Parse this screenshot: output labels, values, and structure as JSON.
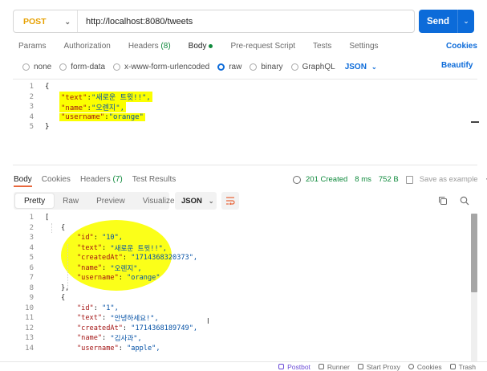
{
  "request": {
    "method": "POST",
    "url": "http://localhost:8080/tweets",
    "send_label": "Send"
  },
  "request_tabs": [
    {
      "label": "Params"
    },
    {
      "label": "Authorization"
    },
    {
      "label": "Headers",
      "count": "(8)"
    },
    {
      "label": "Body"
    },
    {
      "label": "Pre-request Script"
    },
    {
      "label": "Tests"
    },
    {
      "label": "Settings"
    }
  ],
  "cookies_link": "Cookies",
  "body_types": [
    "none",
    "form-data",
    "x-www-form-urlencoded",
    "raw",
    "binary",
    "GraphQL"
  ],
  "body_format": "JSON",
  "beautify_label": "Beautify",
  "request_body_lines": [
    {
      "n": "1",
      "text": "{"
    },
    {
      "n": "2",
      "key": "\"text\"",
      "value": "\"새로운 트윗!!\","
    },
    {
      "n": "3",
      "key": "\"name\"",
      "value": "\"오렌지\","
    },
    {
      "n": "4",
      "key": "\"username\"",
      "value": "\"orange\""
    },
    {
      "n": "5",
      "text": "}"
    }
  ],
  "response_tabs": [
    {
      "label": "Body"
    },
    {
      "label": "Cookies"
    },
    {
      "label": "Headers",
      "count": "(7)"
    },
    {
      "label": "Test Results"
    }
  ],
  "response_meta": {
    "status": "201 Created",
    "time": "8 ms",
    "size": "752 B",
    "save_label": "Save as example",
    "more": "···"
  },
  "view_modes": [
    "Pretty",
    "Raw",
    "Preview",
    "Visualize"
  ],
  "response_format": "JSON",
  "response_lines": [
    {
      "n": "1",
      "indent": 0,
      "text": "["
    },
    {
      "n": "2",
      "indent": 1,
      "text": "{"
    },
    {
      "n": "3",
      "indent": 2,
      "key": "\"id\"",
      "value": "\"10\","
    },
    {
      "n": "4",
      "indent": 2,
      "key": "\"text\"",
      "value": "\"새로운 트윗!!\","
    },
    {
      "n": "5",
      "indent": 2,
      "key": "\"createdAt\"",
      "value": "\"1714368320373\","
    },
    {
      "n": "6",
      "indent": 2,
      "key": "\"name\"",
      "value": "\"오렌지\","
    },
    {
      "n": "7",
      "indent": 2,
      "key": "\"username\"",
      "value": "\"orange\""
    },
    {
      "n": "8",
      "indent": 1,
      "text": "},"
    },
    {
      "n": "9",
      "indent": 1,
      "text": "{"
    },
    {
      "n": "10",
      "indent": 2,
      "key": "\"id\"",
      "value": "\"1\","
    },
    {
      "n": "11",
      "indent": 2,
      "key": "\"text\"",
      "value": "\"안녕하세요!\","
    },
    {
      "n": "12",
      "indent": 2,
      "key": "\"createdAt\"",
      "value": "\"1714368189749\","
    },
    {
      "n": "13",
      "indent": 2,
      "key": "\"name\"",
      "value": "\"김사과\","
    },
    {
      "n": "14",
      "indent": 2,
      "key": "\"username\"",
      "value": "\"apple\","
    }
  ],
  "footer": [
    "Postbot",
    "Runner",
    "Start Proxy",
    "Cookies",
    "Trash"
  ],
  "colors": {
    "accent": "#0c6bd9",
    "method": "#e6a000",
    "status_ok": "#0f8a3c",
    "highlight": "#fbff00"
  }
}
